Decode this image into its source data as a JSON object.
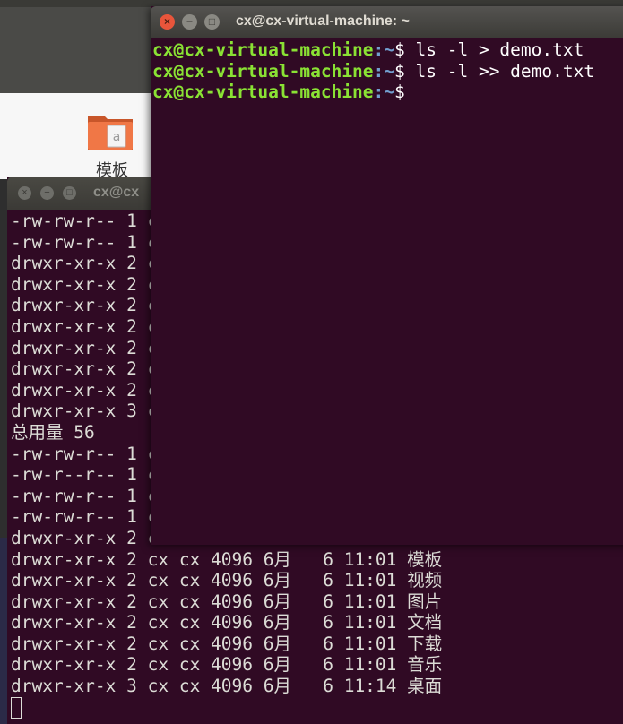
{
  "desktop": {
    "folder_label": "模板"
  },
  "back_terminal": {
    "title": "cx@cx",
    "lines": [
      "-rw-rw-r-- 1 c",
      "-rw-rw-r-- 1 c",
      "drwxr-xr-x 2 c",
      "drwxr-xr-x 2 c",
      "drwxr-xr-x 2 c",
      "drwxr-xr-x 2 c",
      "drwxr-xr-x 2 c",
      "drwxr-xr-x 2 c",
      "drwxr-xr-x 2 c",
      "drwxr-xr-x 3 c",
      "总用量 56",
      "-rw-rw-r-- 1 c",
      "-rw-r--r-- 1 c",
      "-rw-rw-r-- 1 c",
      "-rw-rw-r-- 1 c",
      "drwxr-xr-x 2 c",
      "drwxr-xr-x 2 cx cx 4096 6月   6 11:01 模板",
      "drwxr-xr-x 2 cx cx 4096 6月   6 11:01 视频",
      "drwxr-xr-x 2 cx cx 4096 6月   6 11:01 图片",
      "drwxr-xr-x 2 cx cx 4096 6月   6 11:01 文档",
      "drwxr-xr-x 2 cx cx 4096 6月   6 11:01 下载",
      "drwxr-xr-x 2 cx cx 4096 6月   6 11:01 音乐",
      "drwxr-xr-x 3 cx cx 4096 6月   6 11:14 桌面"
    ]
  },
  "front_terminal": {
    "title": "cx@cx-virtual-machine: ~",
    "prompt_user": "cx@cx-virtual-machine",
    "prompt_path": ":~",
    "prompt_symbol": "$ ",
    "commands": [
      "ls -l > demo.txt",
      "ls -l >> demo.txt",
      ""
    ]
  },
  "colors": {
    "terminal_bg": "#300a24",
    "prompt_green": "#8ae234",
    "prompt_blue": "#729fcf",
    "close_button": "#e8553b"
  },
  "icons": {
    "close": "close-icon",
    "minimize": "minimize-icon",
    "maximize": "maximize-icon",
    "folder": "folder-icon"
  }
}
